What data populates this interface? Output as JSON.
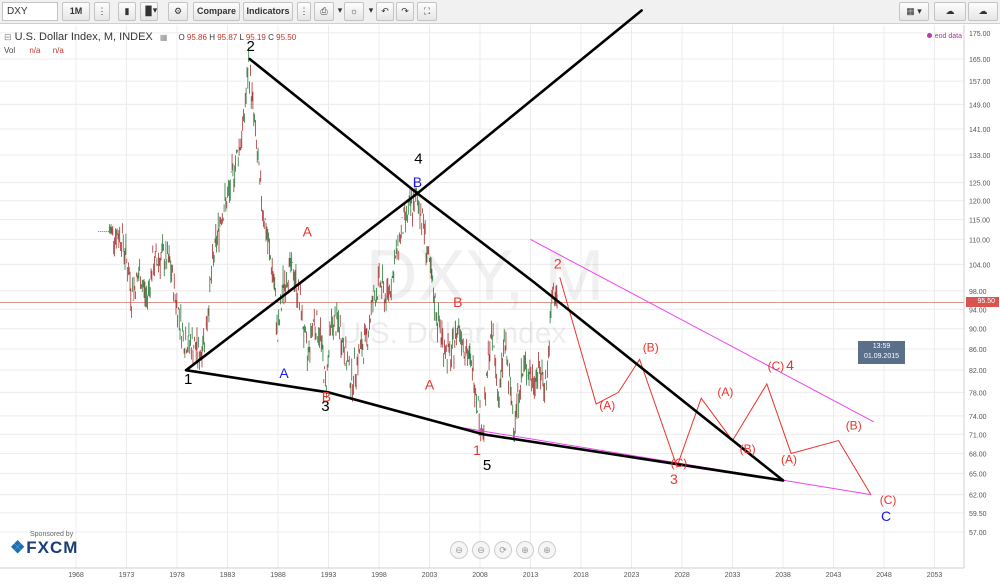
{
  "toolbar": {
    "symbol": "DXY",
    "interval": "1M",
    "compare_label": "Compare",
    "indicators_label": "Indicators",
    "icons": [
      "bars-icon",
      "candle-style-icon",
      "chevron-down-icon",
      "gear-icon",
      "add-indicator-icon",
      "bulb-icon",
      "undo-icon",
      "redo-icon",
      "fullscreen-icon",
      "layout-icon",
      "cloud-icon"
    ]
  },
  "legend": {
    "title": "U.S. Dollar Index, M, INDEX",
    "o_label": "O",
    "o_value": "95.86",
    "h_label": "H",
    "h_value": "95.87",
    "l_label": "L",
    "l_value": "95.19",
    "c_label": "C",
    "c_value": "95.50",
    "vol_label": "Vol",
    "vol_value1": "n/a",
    "vol_value2": "n/a",
    "eod_label": "eod data"
  },
  "watermark": {
    "symbol": "DXY, M",
    "name": "U.S. Dollar Index"
  },
  "crosshair": {
    "time": "13:59",
    "date": "01.09.2015",
    "price_label": "95.50"
  },
  "sponsor": {
    "label": "Sponsored by",
    "brand": "FXCM"
  },
  "colors": {
    "price_line": "#c0392b",
    "black_lines": "#000000",
    "projection": "#e8352c",
    "channel": "#ee44ee",
    "wave_black": "#000000",
    "wave_blue": "#1a1ae6",
    "wave_red": "#e8352c"
  },
  "chart_data": {
    "type": "line",
    "title": "",
    "xlabel": "",
    "ylabel": "",
    "x_ticks": [
      "1968",
      "1973",
      "1978",
      "1983",
      "1988",
      "1993",
      "1998",
      "2003",
      "2008",
      "2013",
      "2018",
      "2023",
      "2028",
      "2033",
      "2038",
      "2043",
      "2048",
      "2053"
    ],
    "y_ticks": [
      "175.00",
      "165.00",
      "157.00",
      "149.00",
      "141.00",
      "133.00",
      "125.00",
      "120.00",
      "115.00",
      "110.00",
      "104.00",
      "98.00",
      "94.00",
      "90.00",
      "86.00",
      "82.00",
      "78.00",
      "74.00",
      "71.00",
      "68.00",
      "65.00",
      "62.00",
      "59.50",
      "57.00"
    ],
    "ylim": [
      55,
      180
    ],
    "y_scale": "log",
    "current_price": 95.5,
    "price_series": [
      [
        1971.3,
        112
      ],
      [
        1972.5,
        111
      ],
      [
        1973.2,
        103
      ],
      [
        1973.5,
        97
      ],
      [
        1974.3,
        102
      ],
      [
        1975.0,
        96
      ],
      [
        1975.6,
        104
      ],
      [
        1976.5,
        106
      ],
      [
        1977.3,
        104
      ],
      [
        1977.9,
        96
      ],
      [
        1978.7,
        88
      ],
      [
        1979.5,
        87
      ],
      [
        1980.3,
        85
      ],
      [
        1980.9,
        91
      ],
      [
        1981.6,
        105
      ],
      [
        1982.4,
        117
      ],
      [
        1983.1,
        121
      ],
      [
        1983.8,
        131
      ],
      [
        1984.5,
        140
      ],
      [
        1985.1,
        163
      ],
      [
        1985.6,
        145
      ],
      [
        1986.2,
        124
      ],
      [
        1986.9,
        111
      ],
      [
        1987.6,
        100
      ],
      [
        1987.98,
        88
      ],
      [
        1988.5,
        99
      ],
      [
        1989.1,
        103
      ],
      [
        1989.6,
        102
      ],
      [
        1990.3,
        94
      ],
      [
        1990.9,
        84
      ],
      [
        1991.5,
        92
      ],
      [
        1992.2,
        89
      ],
      [
        1992.7,
        79
      ],
      [
        1993.3,
        91
      ],
      [
        1994.0,
        91
      ],
      [
        1994.8,
        84
      ],
      [
        1995.3,
        80
      ],
      [
        1996.0,
        85
      ],
      [
        1996.8,
        88
      ],
      [
        1997.4,
        96
      ],
      [
        1998.1,
        100
      ],
      [
        1998.7,
        96
      ],
      [
        1999.3,
        101
      ],
      [
        2000.2,
        112
      ],
      [
        2000.9,
        117
      ],
      [
        2001.4,
        119
      ],
      [
        2001.8,
        121
      ],
      [
        2002.4,
        114
      ],
      [
        2003.0,
        103
      ],
      [
        2003.8,
        92
      ],
      [
        2004.4,
        87
      ],
      [
        2005.1,
        84
      ],
      [
        2005.9,
        91
      ],
      [
        2006.6,
        86
      ],
      [
        2007.4,
        81
      ],
      [
        2008.0,
        74
      ],
      [
        2008.3,
        71
      ],
      [
        2008.9,
        86
      ],
      [
        2009.3,
        88
      ],
      [
        2009.9,
        76
      ],
      [
        2010.4,
        88
      ],
      [
        2011.0,
        78
      ],
      [
        2011.4,
        73
      ],
      [
        2012.0,
        80
      ],
      [
        2012.6,
        83
      ],
      [
        2013.2,
        80
      ],
      [
        2013.8,
        82
      ],
      [
        2014.4,
        80
      ],
      [
        2014.6,
        80
      ],
      [
        2015.2,
        98
      ],
      [
        2015.6,
        96
      ],
      [
        2015.66,
        95.5
      ]
    ],
    "series": [
      {
        "values": [
          [
            1978.9,
            82
          ],
          [
            1993.0,
            78
          ],
          [
            2008.3,
            71
          ],
          [
            2038.0,
            64
          ]
        ]
      },
      {
        "values": [
          [
            1978.9,
            82
          ],
          [
            2001.8,
            122
          ],
          [
            2024.0,
            184
          ]
        ]
      },
      {
        "values": [
          [
            1985.2,
            165
          ],
          [
            2001.8,
            122
          ],
          [
            2013.3,
            100
          ],
          [
            2038.0,
            64
          ]
        ]
      },
      {
        "values": [
          [
            2015.9,
            101
          ],
          [
            2019.5,
            76
          ],
          [
            2021.7,
            78
          ],
          [
            2023.8,
            84
          ],
          [
            2027.5,
            66
          ],
          [
            2029.9,
            77
          ],
          [
            2033.0,
            70
          ],
          [
            2036.4,
            79.5
          ],
          [
            2038.8,
            68
          ],
          [
            2043.5,
            70
          ],
          [
            2046.7,
            62
          ]
        ]
      },
      {
        "values": [
          [
            2013.0,
            110
          ],
          [
            2047.0,
            73
          ]
        ]
      },
      {
        "values": [
          [
            2004.6,
            72.5
          ],
          [
            2046.7,
            62
          ]
        ]
      }
    ],
    "annotations": [
      {
        "text": "1",
        "x": 1979.1,
        "y": 79.5,
        "color": "black"
      },
      {
        "text": "2",
        "x": 1985.3,
        "y": 168,
        "color": "black"
      },
      {
        "text": "3",
        "x": 1992.7,
        "y": 74.8,
        "color": "black"
      },
      {
        "text": "4",
        "x": 2001.9,
        "y": 130.5,
        "color": "black"
      },
      {
        "text": "5",
        "x": 2008.7,
        "y": 65.5,
        "color": "black"
      },
      {
        "text": "A",
        "x": 1988.6,
        "y": 80.6,
        "color": "blue"
      },
      {
        "text": "B",
        "x": 2001.8,
        "y": 123.8,
        "color": "blue"
      },
      {
        "text": "C",
        "x": 2048.2,
        "y": 58.4,
        "color": "blue"
      },
      {
        "text": "A",
        "x": 1990.9,
        "y": 110.7,
        "color": "red"
      },
      {
        "text": "B",
        "x": 1992.8,
        "y": 76.4,
        "color": "red"
      },
      {
        "text": "A",
        "x": 2003.0,
        "y": 78.5,
        "color": "red"
      },
      {
        "text": "B",
        "x": 2005.8,
        "y": 94.5,
        "color": "red"
      },
      {
        "text": "1",
        "x": 2007.7,
        "y": 67.8,
        "color": "red"
      },
      {
        "text": "2",
        "x": 2015.7,
        "y": 103,
        "color": "red"
      },
      {
        "text": "3",
        "x": 2027.2,
        "y": 63.5,
        "color": "red"
      },
      {
        "text": "4",
        "x": 2038.7,
        "y": 82,
        "color": "red"
      },
      {
        "text": "(A)",
        "x": 2020.6,
        "y": 75.1,
        "color": "red"
      },
      {
        "text": "(B)",
        "x": 2024.9,
        "y": 85.5,
        "color": "red"
      },
      {
        "text": "(C)",
        "x": 2027.7,
        "y": 66.0,
        "color": "red"
      },
      {
        "text": "(A)",
        "x": 2032.3,
        "y": 77.4,
        "color": "red"
      },
      {
        "text": "(B)",
        "x": 2034.5,
        "y": 68.1,
        "color": "red"
      },
      {
        "text": "(C)",
        "x": 2037.3,
        "y": 82.0,
        "color": "red"
      },
      {
        "text": "(A)",
        "x": 2038.6,
        "y": 66.5,
        "color": "red"
      },
      {
        "text": "(B)",
        "x": 2045.0,
        "y": 71.8,
        "color": "red"
      },
      {
        "text": "(C)",
        "x": 2048.4,
        "y": 60.7,
        "color": "red"
      }
    ],
    "grid": true,
    "legend": "top-left"
  }
}
